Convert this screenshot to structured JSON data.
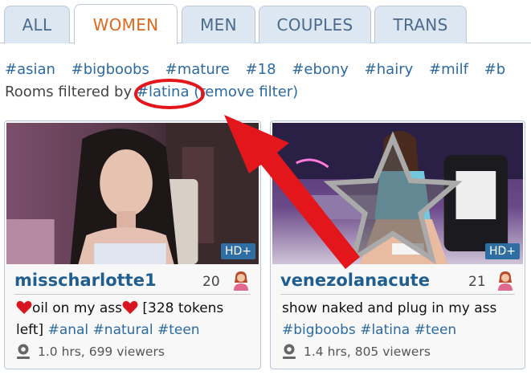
{
  "tabs": [
    {
      "label": "ALL",
      "active": false
    },
    {
      "label": "WOMEN",
      "active": true
    },
    {
      "label": "MEN",
      "active": false
    },
    {
      "label": "COUPLES",
      "active": false
    },
    {
      "label": "TRANS",
      "active": false
    }
  ],
  "tags": [
    "#asian",
    "#bigboobs",
    "#mature",
    "#18",
    "#ebony",
    "#hairy",
    "#milf",
    "#b"
  ],
  "filter": {
    "prefix": "Rooms filtered by ",
    "tag": "#latina",
    "remove": "(remove filter)"
  },
  "rooms": [
    {
      "username": "misscharlotte1",
      "age": "20",
      "badge": "HD+",
      "subject_text_1": "oil on my ass",
      "subject_text_2": " [328 tokens left] ",
      "subject_tags": [
        "#anal",
        "#natural",
        "#teen"
      ],
      "meta": "1.0 hrs, 699 viewers"
    },
    {
      "username": "venezolanacute",
      "age": "21",
      "badge": "HD+",
      "subject_text_1": "show naked and plug in my ass",
      "subject_tags": [
        "#bigboobs",
        "#latina",
        "#teen"
      ],
      "meta": "1.4 hrs, 805 viewers"
    }
  ],
  "colors": {
    "accent": "#e1691d",
    "link": "#2c6aa0",
    "tab_bg": "#dde7f1",
    "annotation": "#e3161c"
  }
}
